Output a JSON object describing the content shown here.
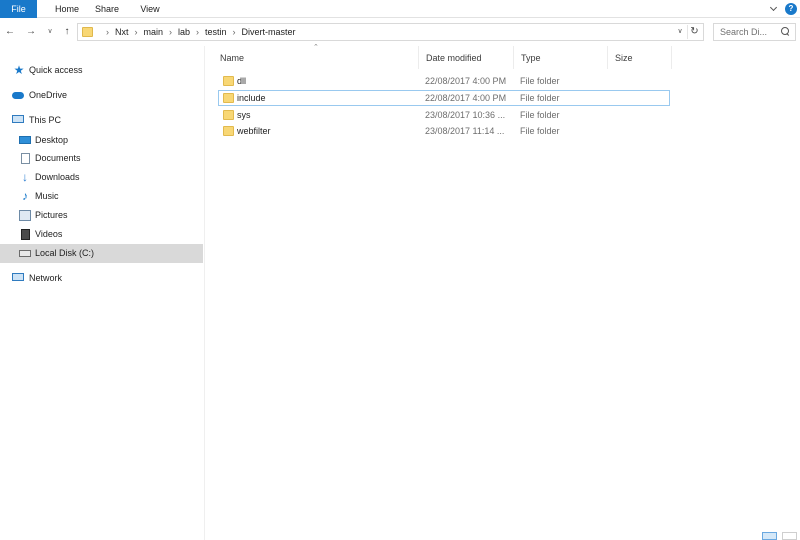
{
  "ribbon": {
    "tabs": [
      "File",
      "Home",
      "Share",
      "View"
    ]
  },
  "address": {
    "crumbs": [
      "Nxt",
      "main",
      "lab",
      "testin",
      "Divert-master"
    ]
  },
  "search": {
    "placeholder": "Search Di..."
  },
  "nav": {
    "items": [
      {
        "label": "Quick access",
        "icon": "star-icon"
      },
      {
        "label": "OneDrive",
        "icon": "cloud-icon"
      },
      {
        "label": "This PC",
        "icon": "computer-icon"
      },
      {
        "label": "Desktop",
        "icon": "desktop-icon"
      },
      {
        "label": "Documents",
        "icon": "documents-icon"
      },
      {
        "label": "Downloads",
        "icon": "downloads-icon"
      },
      {
        "label": "Music",
        "icon": "music-icon"
      },
      {
        "label": "Pictures",
        "icon": "pictures-icon"
      },
      {
        "label": "Videos",
        "icon": "videos-icon"
      },
      {
        "label": "Local Disk (C:)",
        "icon": "drive-icon"
      },
      {
        "label": "Network",
        "icon": "network-icon"
      }
    ]
  },
  "columns": {
    "name": "Name",
    "date": "Date modified",
    "type": "Type",
    "size": "Size"
  },
  "files": [
    {
      "name": "dll",
      "date": "22/08/2017 4:00 PM",
      "type": "File folder"
    },
    {
      "name": "include",
      "date": "22/08/2017 4:00 PM",
      "type": "File folder"
    },
    {
      "name": "sys",
      "date": "23/08/2017 10:36 ...",
      "type": "File folder"
    },
    {
      "name": "webfilter",
      "date": "23/08/2017 11:14 ...",
      "type": "File folder"
    }
  ],
  "colors": {
    "accent": "#1979ca",
    "selected_nav": "#d9d9d9",
    "folder": "#f8d775"
  }
}
